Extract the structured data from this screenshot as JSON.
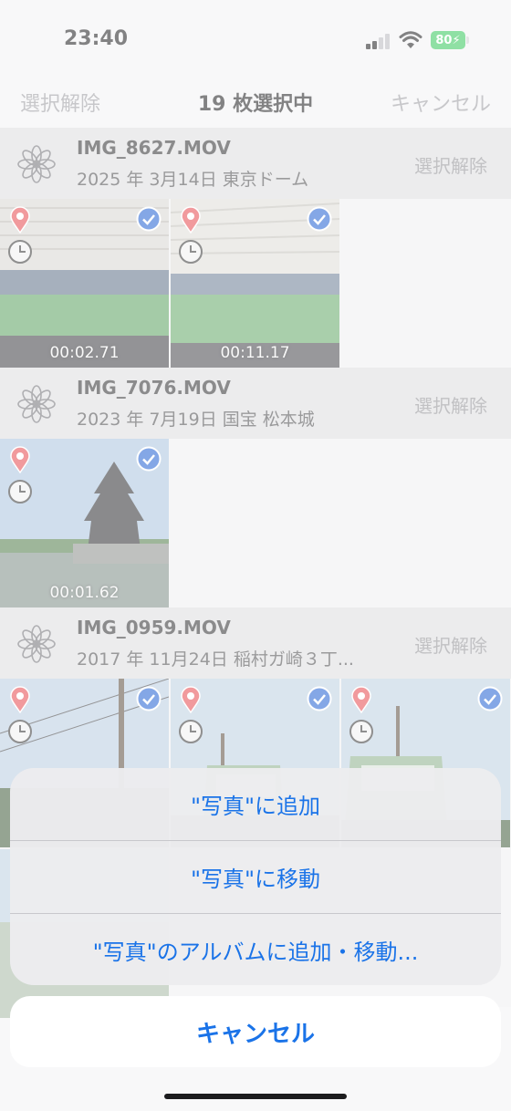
{
  "status_bar": {
    "time": "23:40",
    "battery": "80"
  },
  "nav": {
    "left": "選択解除",
    "title": "19 枚選択中",
    "right": "キャンセル"
  },
  "groups": [
    {
      "title": "IMG_8627.MOV",
      "subtitle": "2025 年 3月14日  東京ドーム",
      "deselect": "選択解除",
      "thumbs": [
        {
          "scene": "stadium",
          "duration": "00:02.71"
        },
        {
          "scene": "stadium",
          "duration": "00:11.17"
        }
      ]
    },
    {
      "title": "IMG_7076.MOV",
      "subtitle": "2023 年 7月19日  国宝 松本城",
      "deselect": "選択解除",
      "thumbs": [
        {
          "scene": "castle",
          "duration": "00:01.62"
        }
      ]
    },
    {
      "title": "IMG_0959.MOV",
      "subtitle": "2017 年 11月24日  稲村ガ崎３丁...",
      "deselect": "選択解除",
      "thumbs": [
        {
          "scene": "train",
          "duration": ""
        },
        {
          "scene": "train",
          "duration": ""
        },
        {
          "scene": "train",
          "duration": ""
        }
      ]
    }
  ],
  "action_sheet": {
    "items": [
      "\"写真\"に追加",
      "\"写真\"に移動",
      "\"写真\"のアルバムに追加・移動..."
    ],
    "cancel": "キャンセル"
  },
  "colors": {
    "accent": "#1a73e8",
    "pin": "#e5484d",
    "check": "#1f5fd1",
    "battery": "#34c759"
  }
}
